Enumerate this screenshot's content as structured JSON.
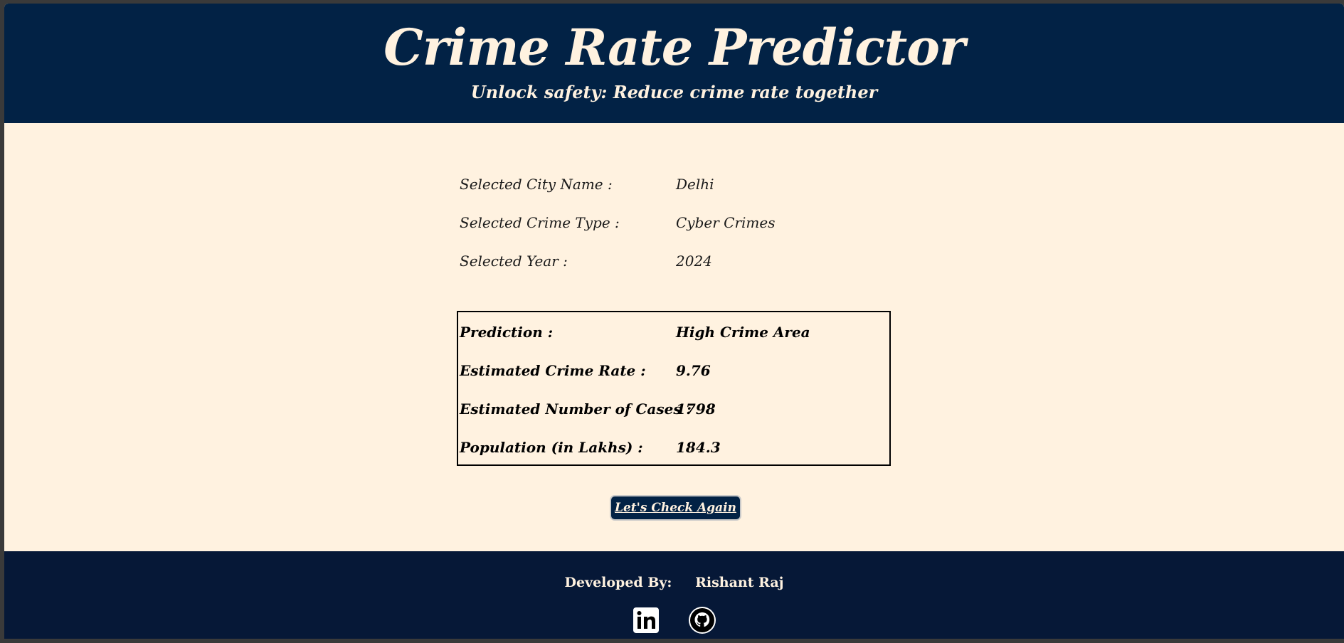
{
  "header": {
    "title": "Crime Rate Predictor",
    "subtitle": "Unlock safety: Reduce crime rate together"
  },
  "selection": {
    "city_label": "Selected City Name :",
    "city_value": "Delhi",
    "crime_type_label": "Selected Crime Type :",
    "crime_type_value": "Cyber Crimes",
    "year_label": "Selected Year :",
    "year_value": "2024"
  },
  "result": {
    "prediction_label": "Prediction :",
    "prediction_value": "High Crime Area",
    "crime_rate_label": "Estimated Crime Rate :",
    "crime_rate_value": "9.76",
    "cases_label": "Estimated Number of Cases :",
    "cases_value": "1798",
    "population_label": "Population (in Lakhs) :",
    "population_value": "184.3"
  },
  "actions": {
    "check_again_label": "Let's Check Again"
  },
  "footer": {
    "developed_by_label": "Developed By:",
    "developer_name": "Rishant Raj",
    "icons": [
      "linkedin-icon",
      "github-icon"
    ]
  },
  "colors": {
    "header_bg": "#022245",
    "footer_bg": "#061837",
    "page_bg": "#fff2e0",
    "text_light": "#fff2e0"
  }
}
